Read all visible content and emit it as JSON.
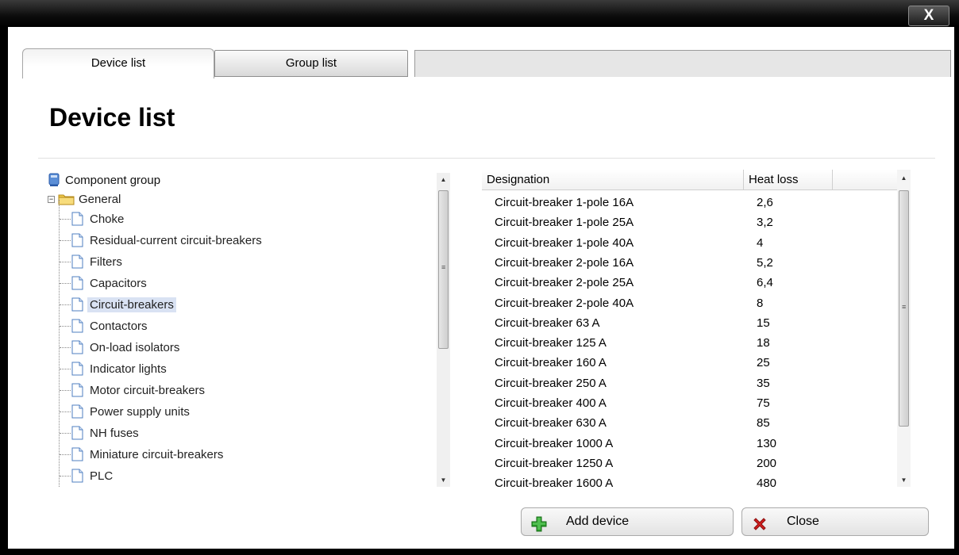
{
  "window": {
    "close_label": "X"
  },
  "tabs": [
    {
      "label": "Device list",
      "active": true
    },
    {
      "label": "Group list",
      "active": false
    }
  ],
  "page": {
    "title": "Device list"
  },
  "tree": {
    "root_label": "Component group",
    "group_label": "General",
    "group_expander": "−",
    "items": [
      {
        "label": "Choke",
        "selected": false
      },
      {
        "label": "Residual-current circuit-breakers",
        "selected": false
      },
      {
        "label": "Filters",
        "selected": false
      },
      {
        "label": "Capacitors",
        "selected": false
      },
      {
        "label": "Circuit-breakers",
        "selected": true
      },
      {
        "label": "Contactors",
        "selected": false
      },
      {
        "label": "On-load isolators",
        "selected": false
      },
      {
        "label": "Indicator lights",
        "selected": false
      },
      {
        "label": "Motor circuit-breakers",
        "selected": false
      },
      {
        "label": "Power supply units",
        "selected": false
      },
      {
        "label": "NH fuses",
        "selected": false
      },
      {
        "label": "Miniature circuit-breakers",
        "selected": false
      },
      {
        "label": "PLC",
        "selected": false
      }
    ]
  },
  "table": {
    "columns": [
      "Designation",
      "Heat loss"
    ],
    "rows": [
      [
        "Circuit-breaker 1-pole 16A",
        "2,6"
      ],
      [
        "Circuit-breaker 1-pole 25A",
        "3,2"
      ],
      [
        "Circuit-breaker 1-pole 40A",
        "4"
      ],
      [
        "Circuit-breaker 2-pole 16A",
        "5,2"
      ],
      [
        "Circuit-breaker 2-pole 25A",
        "6,4"
      ],
      [
        "Circuit-breaker 2-pole 40A",
        "8"
      ],
      [
        "Circuit-breaker 63 A",
        "15"
      ],
      [
        "Circuit-breaker 125 A",
        "18"
      ],
      [
        "Circuit-breaker 160 A",
        "25"
      ],
      [
        "Circuit-breaker 250 A",
        "35"
      ],
      [
        "Circuit-breaker 400 A",
        "75"
      ],
      [
        "Circuit-breaker 630 A",
        "85"
      ],
      [
        "Circuit-breaker 1000 A",
        "130"
      ],
      [
        "Circuit-breaker 1250 A",
        "200"
      ],
      [
        "Circuit-breaker 1600 A",
        "480"
      ]
    ]
  },
  "buttons": {
    "add_device": {
      "label": "Add device",
      "icon": "plus-icon",
      "color": "#2a9d2a"
    },
    "close": {
      "label": "Close",
      "icon": "x-icon",
      "color": "#d42020"
    }
  },
  "colors": {
    "selection": "#d9e2f3",
    "folder": "#f0c94a"
  }
}
